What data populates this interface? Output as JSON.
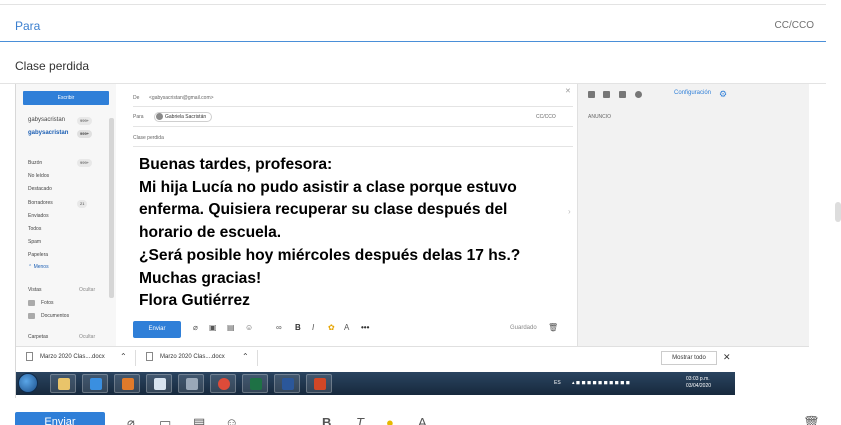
{
  "compose": {
    "to_label": "Para",
    "cc_label": "CC/CCO",
    "subject": "Clase perdida",
    "send_label": "Enviar"
  },
  "screenshot": {
    "sidebar": {
      "write_button": "Escribir",
      "accounts": [
        {
          "name": "gabysacristan",
          "count": "999+"
        },
        {
          "name": "gabysacristan",
          "count": "999+"
        }
      ],
      "folders": [
        {
          "label": "Buzón",
          "count": "999+"
        },
        {
          "label": "No leídos"
        },
        {
          "label": "Destacado"
        },
        {
          "label": "Borradores",
          "count": "21"
        },
        {
          "label": "Enviados"
        },
        {
          "label": "Todos"
        },
        {
          "label": "Spam"
        },
        {
          "label": "Papelera"
        },
        {
          "label": "⌃ Menos"
        }
      ],
      "views_label": "Vistas",
      "views_hide": "Ocultar",
      "views": [
        "Fotos",
        "Documentos"
      ],
      "folders2_label": "Carpetas",
      "folders2_hide": "Ocultar"
    },
    "message": {
      "from_label": "De",
      "from_value": "<gabysacristan@gmail.com>",
      "to_label": "Para",
      "to_chip": "Gabriela Sacristán",
      "cc_label": "CC/CCO",
      "subject": "Clase perdida",
      "body_lines": [
        "Buenas tardes, profesora:",
        "Mi hija Lucía no pudo asistir a clase porque estuvo",
        "enferma. Quisiera recuperar su clase después del",
        "horario de escuela.",
        "¿Será posible hoy miércoles después delas 17 hs.?",
        "Muchas gracias!",
        "Flora Gutiérrez"
      ],
      "send_button": "Enviar",
      "saved_label": "Guardado"
    },
    "right_pane": {
      "settings_label": "Configuración",
      "ad_label": "ANUNCIO"
    },
    "downloads": {
      "items": [
        "Marzo 2020 Clas....docx",
        "Marzo 2020 Clas....docx"
      ],
      "show_all": "Mostrar todo"
    },
    "taskbar": {
      "lang": "ES",
      "time": "03:03 p.m.",
      "date": "03/04/2020"
    }
  },
  "colors": {
    "accent": "#2f7fd8",
    "to_label": "#3b7fcf",
    "taskbar": "#1f344c"
  },
  "icons": [
    "search-icon",
    "gear-icon",
    "close-icon",
    "chevron-up-icon",
    "chevron-down-icon",
    "attach-icon",
    "image-icon",
    "emoji-icon",
    "link-icon",
    "bold-icon",
    "italic-icon",
    "color-icon",
    "font-size-icon",
    "more-icon",
    "trash-icon"
  ]
}
